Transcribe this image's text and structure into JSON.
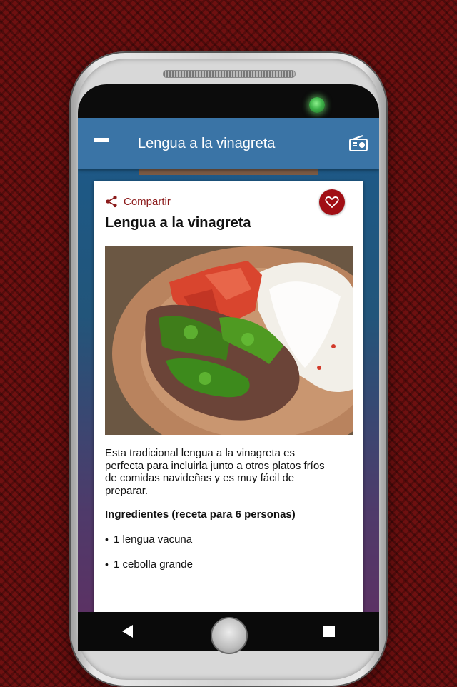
{
  "app": {
    "title": "Lengua a la vinagreta"
  },
  "card": {
    "share_label": "Compartir",
    "recipe_title": "Lengua a la vinagreta",
    "description": "Esta tradicional lengua a la vinagreta es perfecta para incluirla junto a otros platos fríos de comidas navideñas y es muy fácil de preparar.",
    "ingredients_heading": "Ingredientes (receta para 6 personas)",
    "ingredients": [
      "1 lengua vacuna",
      "1 cebolla grande"
    ],
    "bullet": "•"
  },
  "icons": {
    "menu": "menu-icon",
    "radio": "radio-icon",
    "share": "share-icon",
    "favorite": "heart-icon",
    "back": "back-icon",
    "home": "home-icon",
    "recents": "recents-icon"
  },
  "colors": {
    "appbar": "#3a74a6",
    "accent": "#a10e14",
    "share_text": "#8b1a1a",
    "background": "#6e1010"
  }
}
